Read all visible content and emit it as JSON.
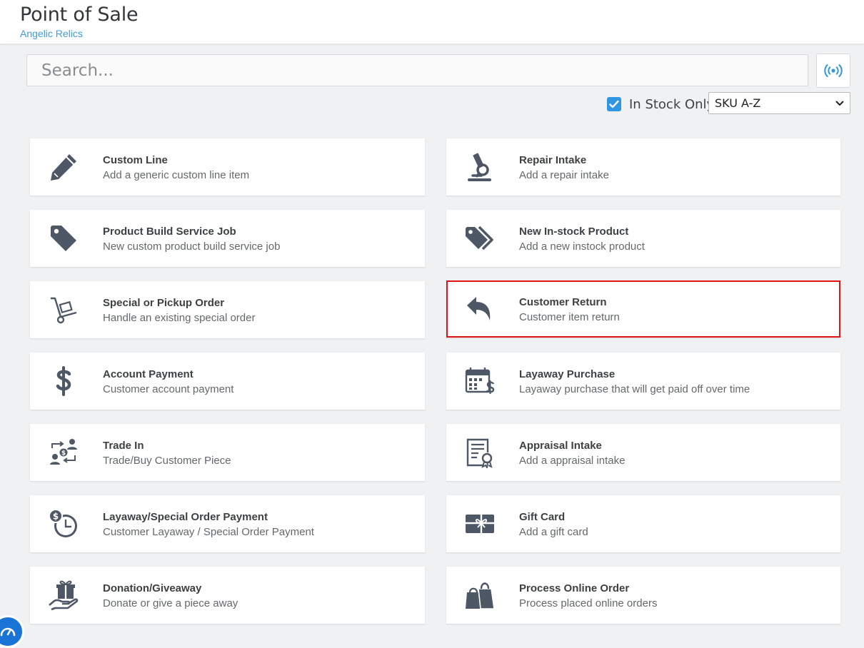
{
  "header": {
    "title": "Point of Sale",
    "subtitle": "Angelic Relics"
  },
  "search": {
    "placeholder": "Search...",
    "value": ""
  },
  "filters": {
    "in_stock_label": "In Stock Only",
    "in_stock_checked": true,
    "sort_selected": "SKU A-Z"
  },
  "icons": {
    "broadcast": "broadcast-icon",
    "checkbox": "check-icon",
    "sort": "chevron-down-icon"
  },
  "colors": {
    "accent": "#2f96e1",
    "highlight_border": "#e11414",
    "icon": "#4e5766"
  },
  "tiles": [
    {
      "title": "Custom Line",
      "description": "Add a generic custom line item",
      "icon": "pencil-icon"
    },
    {
      "title": "Repair Intake",
      "description": "Add a repair intake",
      "icon": "microscope-icon"
    },
    {
      "title": "Product Build Service Job",
      "description": "New custom product build service job",
      "icon": "tag-icon"
    },
    {
      "title": "New In-stock Product",
      "description": "Add a new instock product",
      "icon": "tags-icon"
    },
    {
      "title": "Special or Pickup Order",
      "description": "Handle an existing special order",
      "icon": "hand-truck-icon"
    },
    {
      "title": "Customer Return",
      "description": "Customer item return",
      "icon": "reply-arrow-icon",
      "highlighted": true
    },
    {
      "title": "Account Payment",
      "description": "Customer account payment",
      "icon": "dollar-icon"
    },
    {
      "title": "Layaway Purchase",
      "description": "Layaway purchase that will get paid off over time",
      "icon": "calendar-dollar-icon"
    },
    {
      "title": "Trade In",
      "description": "Trade/Buy Customer Piece",
      "icon": "trade-exchange-icon"
    },
    {
      "title": "Appraisal Intake",
      "description": "Add a appraisal intake",
      "icon": "certificate-icon"
    },
    {
      "title": "Layaway/Special Order Payment",
      "description": "Customer Layaway / Special Order Payment",
      "icon": "clock-dollar-icon"
    },
    {
      "title": "Gift Card",
      "description": "Add a gift card",
      "icon": "gift-card-icon"
    },
    {
      "title": "Donation/Giveaway",
      "description": "Donate or give a piece away",
      "icon": "hand-gift-icon"
    },
    {
      "title": "Process Online Order",
      "description": "Process placed online orders",
      "icon": "shopping-bags-icon"
    }
  ]
}
